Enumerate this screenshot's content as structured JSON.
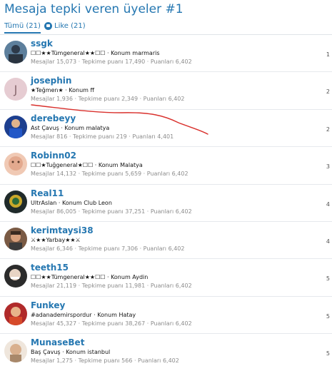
{
  "page": {
    "title": "Mesaja tepki veren üyeler #1"
  },
  "tabs": [
    {
      "label": "Tümü (21)",
      "active": true
    },
    {
      "label": "Like (21)",
      "icon": "like-icon",
      "active": false
    }
  ],
  "colors": {
    "link": "#2577b1",
    "annotation": "#d9302c"
  },
  "users": [
    {
      "name": "ssgk",
      "blurb": "☐☐★★Tümgeneral★★☐☐ · Konum marmaris",
      "stats": "Mesajlar 15,073 · Tepkime puanı 17,490 · Puanları 6,402",
      "count": "1"
    },
    {
      "name": "josephin",
      "avatar_letter": "J",
      "blurb": "★Teğmen★ · Konum ff",
      "stats": "Mesajlar 1,936 · Tepkime puanı 2,349 · Puanları 6,402",
      "count": "2"
    },
    {
      "name": "derebeyy",
      "blurb": "Ast Çavuş · Konum malatya",
      "stats": "Mesajlar 816 · Tepkime puanı 219 · Puanları 4,401",
      "count": "2"
    },
    {
      "name": "Robinn02",
      "blurb": "☐☐★Tuğgeneral★☐☐ · Konum Malatya",
      "stats": "Mesajlar 14,132 · Tepkime puanı 5,659 · Puanları 6,402",
      "count": "3"
    },
    {
      "name": "Real11",
      "blurb": "UltrAslan · Konum Club Leon",
      "stats": "Mesajlar 86,005 · Tepkime puanı 37,251 · Puanları 6,402",
      "count": "4"
    },
    {
      "name": "kerimtaysi38",
      "blurb": "⚔★★Yarbay★★⚔",
      "stats": "Mesajlar 6,346 · Tepkime puanı 7,306 · Puanları 6,402",
      "count": "4"
    },
    {
      "name": "teeth15",
      "blurb": "☐☐★★Tümgeneral★★☐☐ · Konum Aydin",
      "stats": "Mesajlar 21,119 · Tepkime puanı 11,981 · Puanları 6,402",
      "count": "5"
    },
    {
      "name": "Funkey",
      "blurb": "#adanademirspordur · Konum Hatay",
      "stats": "Mesajlar 45,327 · Tepkime puanı 38,267 · Puanları 6,402",
      "count": "5"
    },
    {
      "name": "MunaseBet",
      "blurb": "Baş Çavuş · Konum istanbul",
      "stats": "Mesajlar 1,275 · Tepkime puanı 566 · Puanları 6,402",
      "count": "5"
    }
  ]
}
